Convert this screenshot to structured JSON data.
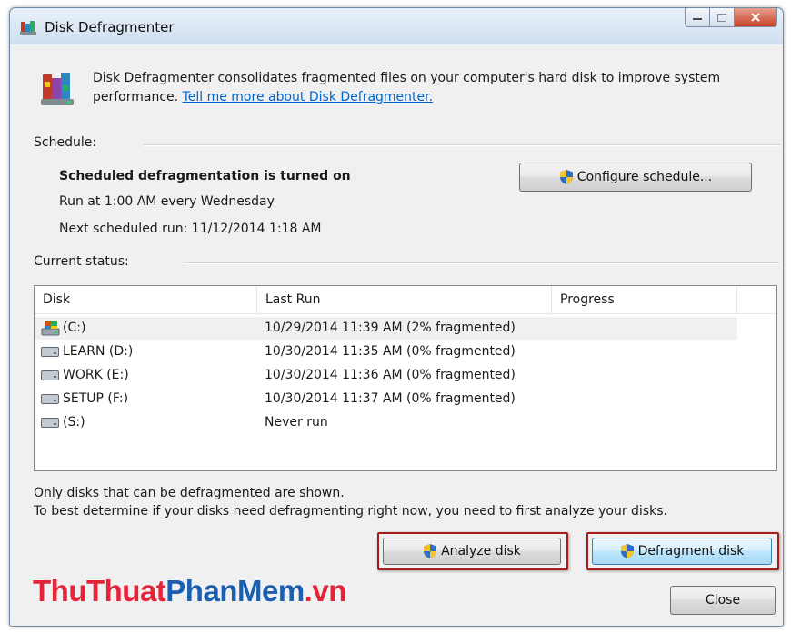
{
  "window": {
    "title": "Disk Defragmenter"
  },
  "header": {
    "description": "Disk Defragmenter consolidates fragmented files on your computer's hard disk to improve system performance.",
    "link": "Tell me more about Disk Defragmenter."
  },
  "schedule": {
    "group_label": "Schedule:",
    "status": "Scheduled defragmentation is turned on",
    "run_at": "Run at 1:00 AM every Wednesday",
    "next_run": "Next scheduled run: 11/12/2014 1:18 AM",
    "configure_button": "Configure schedule..."
  },
  "status": {
    "group_label": "Current status:",
    "columns": [
      "Disk",
      "Last Run",
      "Progress"
    ],
    "disks": [
      {
        "name": "(C:)",
        "last_run": "10/29/2014 11:39 AM (2% fragmented)",
        "progress": "",
        "icon": "system-drive-icon"
      },
      {
        "name": "LEARN (D:)",
        "last_run": "10/30/2014 11:35 AM (0% fragmented)",
        "progress": "",
        "icon": "hard-drive-icon"
      },
      {
        "name": "WORK (E:)",
        "last_run": "10/30/2014 11:36 AM (0% fragmented)",
        "progress": "",
        "icon": "hard-drive-icon"
      },
      {
        "name": "SETUP (F:)",
        "last_run": "10/30/2014 11:37 AM (0% fragmented)",
        "progress": "",
        "icon": "hard-drive-icon"
      },
      {
        "name": "(S:)",
        "last_run": "Never run",
        "progress": "",
        "icon": "hard-drive-icon"
      }
    ]
  },
  "notes": {
    "line1": "Only disks that can be defragmented are shown.",
    "line2": "To best determine if your disks need defragmenting right now, you need to first analyze your disks."
  },
  "buttons": {
    "analyze": "Analyze disk",
    "defragment": "Defragment disk",
    "close": "Close"
  },
  "watermark": {
    "part1": "ThuThuat",
    "part2": "PhanMem",
    "part3": ".vn"
  },
  "colors": {
    "link": "#0066cc",
    "highlight_border": "#a51d1d",
    "watermark_red": "#e5243a",
    "watermark_blue": "#1b5fb3"
  }
}
